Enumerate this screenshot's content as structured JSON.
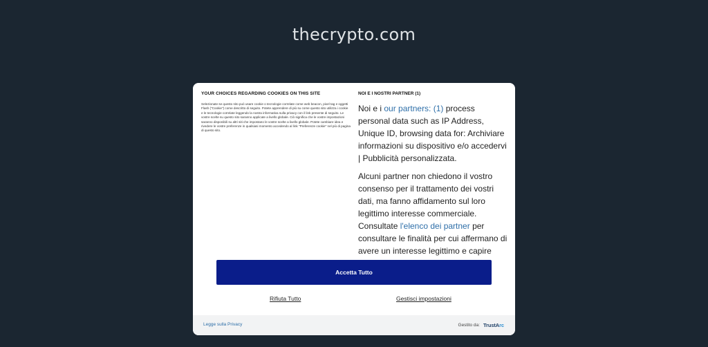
{
  "page": {
    "site_title": "thecrypto.com"
  },
  "consent": {
    "left": {
      "heading": "YOUR CHOICES REGARDING COOKIES ON THIS SITE",
      "body": "Selezionate se questo sito può usare cookie o tecnologie correlate come web beacon, pixel tag e oggetti Flash (\"Cookie\") come descritto di seguito. Potete apprendere di più su come questo sito utilizza i cookie e le tecnologie correlate leggendo la nostra informativa sulla privacy con il link presente di seguito. Le vostre scelte su questo sito saranno applicate a livello globale. Ciò significa che le vostre impostazioni saranno disponibili su altri siti che impostano le vostre scelte a livello globale. Potete cambiare idea e rivedere le vostre preferenze in qualsiasi momento accedendo al link \"Preferenze cookie\" nel più di pagina di questo sito."
    },
    "right": {
      "heading": "NOI E I NOSTRI PARTNER (1)",
      "p1_prefix": "Noi e i ",
      "p1_link": "our partners: (1)",
      "p1_suffix": " process personal data such as IP Address, Unique ID, browsing data for: Archiviare informazioni su dispositivo e/o accedervi | Pubblicità personalizzata.",
      "p2_prefix": "Alcuni partner non chiedono il vostro consenso per il trattamento dei vostri dati, ma fanno affidamento sul loro legittimo interesse commerciale. Consultate ",
      "p2_link": "l'elenco dei partner",
      "p2_suffix": " per consultare le finalità per cui affermano di avere un interesse legittimo e capire come potete opporvi."
    },
    "accept_label": "Accetta Tutto",
    "reject_label": "Rifiuta Tutto",
    "manage_label": "Gestisci impostazioni",
    "footer": {
      "privacy_label": "Legge sulla Privacy",
      "managed_by_label": "Gestito da:",
      "logo_text_a": "TrustA",
      "logo_text_b": "rc"
    },
    "colors": {
      "accent": "#0a1d8a",
      "link": "#2d6ea8",
      "background": "#1b2631"
    }
  }
}
